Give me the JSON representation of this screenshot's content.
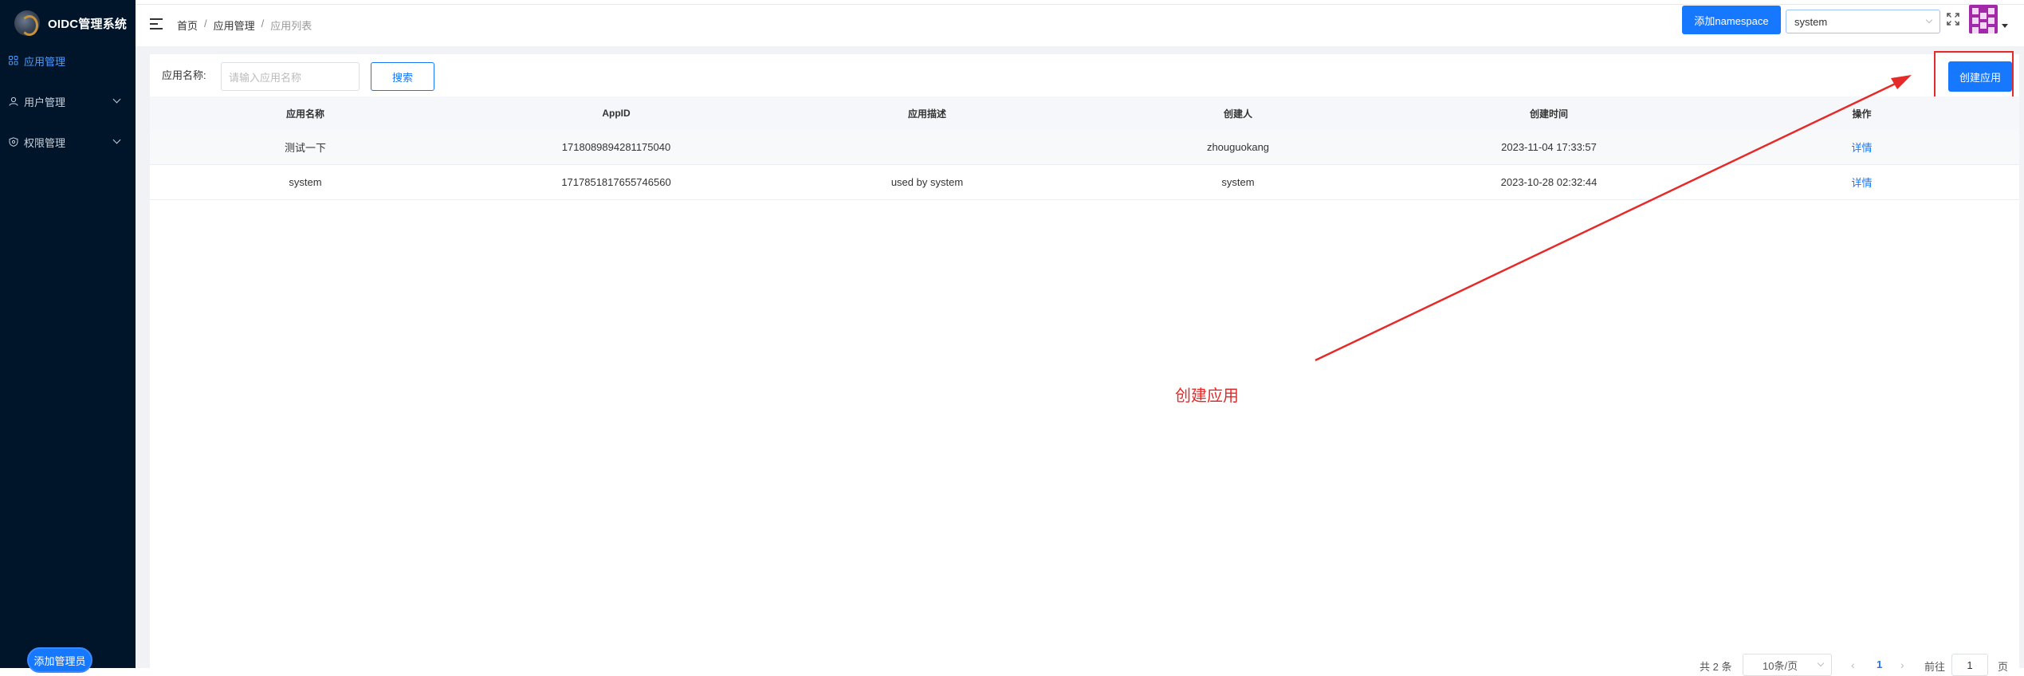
{
  "app": {
    "title": "OIDC管理系统"
  },
  "sidebar": {
    "items": [
      {
        "label": "应用管理",
        "icon": "grid-icon",
        "active": true
      },
      {
        "label": "用户管理",
        "icon": "user-icon",
        "active": false
      },
      {
        "label": "权限管理",
        "icon": "shield-icon",
        "active": false
      }
    ],
    "add_admin_label": "添加管理员"
  },
  "header": {
    "breadcrumb": [
      "首页",
      "应用管理",
      "应用列表"
    ],
    "separator": "/",
    "add_namespace_label": "添加namespace",
    "namespace_value": "system"
  },
  "search": {
    "label": "应用名称:",
    "placeholder": "请输入应用名称",
    "button_label": "搜索"
  },
  "create_button_label": "创建应用",
  "table": {
    "columns": [
      "应用名称",
      "AppID",
      "应用描述",
      "创建人",
      "创建时间",
      "操作"
    ],
    "rows": [
      [
        "测试一下",
        "1718089894281175040",
        "",
        "zhouguokang",
        "2023-11-04 17:33:57",
        "详情"
      ],
      [
        "system",
        "1717851817655746560",
        "used by system",
        "system",
        "2023-10-28 02:32:44",
        "详情"
      ]
    ]
  },
  "annotation": {
    "text": "创建应用",
    "color": "#e52a2a"
  },
  "pagination": {
    "total_text": "共 2 条",
    "page_size": "10条/页",
    "current_page": "1",
    "goto_label": "前往",
    "goto_value": "1",
    "unit": "页"
  },
  "colors": {
    "primary": "#1677ff",
    "sidebar": "#001529",
    "annotation": "#e52a2a"
  }
}
